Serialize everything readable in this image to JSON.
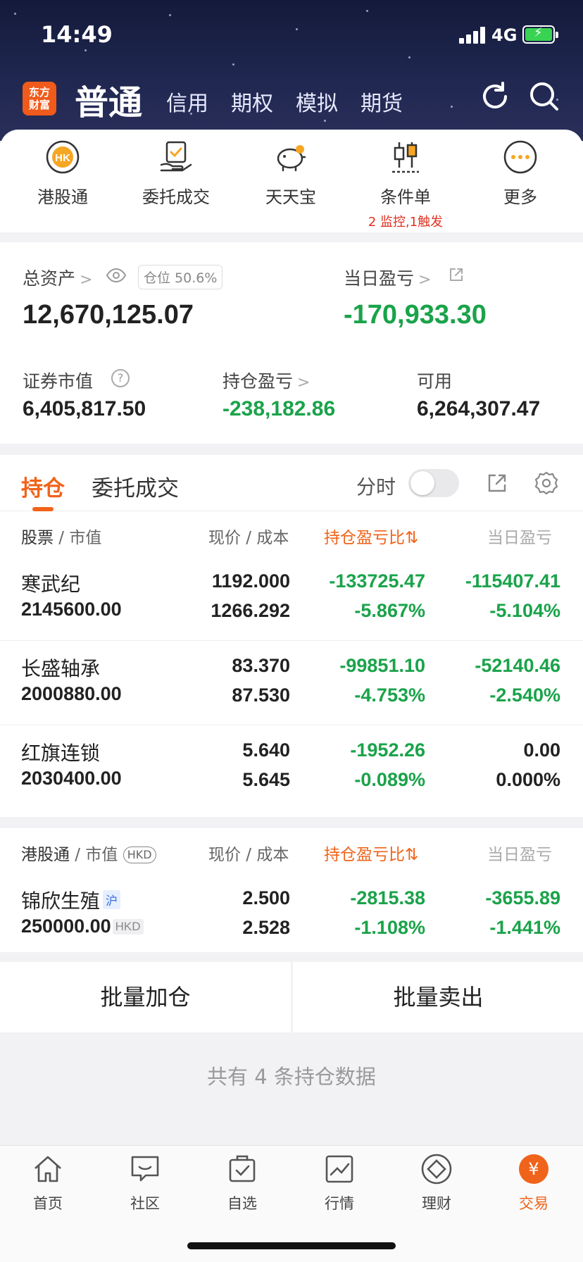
{
  "status": {
    "time": "14:49",
    "network": "4G"
  },
  "header": {
    "logo_line1": "东方",
    "logo_line2": "财富",
    "tabs": [
      "普通",
      "信用",
      "期权",
      "模拟",
      "期货"
    ],
    "active_tab": "普通"
  },
  "quick_entries": [
    {
      "label": "港股通",
      "icon": "hk-badge-icon"
    },
    {
      "label": "委托成交",
      "icon": "order-hand-icon"
    },
    {
      "label": "天天宝",
      "icon": "piggy-bank-icon"
    },
    {
      "label": "条件单",
      "icon": "candlestick-icon",
      "note": "2 监控,1触发"
    },
    {
      "label": "更多",
      "icon": "more-dots-icon"
    }
  ],
  "assets": {
    "total_label": "总资产",
    "total_value": "12,670,125.07",
    "position_badge": "仓位 50.6%",
    "daily_pl_label": "当日盈亏",
    "daily_pl_value": "-170,933.30",
    "securities_label": "证券市值",
    "securities_value": "6,405,817.50",
    "holding_pl_label": "持仓盈亏",
    "holding_pl_value": "-238,182.86",
    "available_label": "可用",
    "available_value": "6,264,307.47"
  },
  "holdings": {
    "tab_active": "持仓",
    "tab_other": "委托成交",
    "fenshi_label": "分时",
    "fenshi_on": false,
    "columns": {
      "stock": "股票",
      "stock_sub": "市值",
      "price": "现价",
      "price_sub": "成本",
      "pl_ratio": "持仓盈亏比",
      "daily": "当日盈亏"
    },
    "a_rows": [
      {
        "name": "寒武纪",
        "mv": "2145600.00",
        "price": "1192.000",
        "cost": "1266.292",
        "pl": "-133725.47",
        "pl_pct": "-5.867%",
        "daily": "-115407.41",
        "daily_pct": "-5.104%"
      },
      {
        "name": "长盛轴承",
        "mv": "2000880.00",
        "price": "83.370",
        "cost": "87.530",
        "pl": "-99851.10",
        "pl_pct": "-4.753%",
        "daily": "-52140.46",
        "daily_pct": "-2.540%"
      },
      {
        "name": "红旗连锁",
        "mv": "2030400.00",
        "price": "5.640",
        "cost": "5.645",
        "pl": "-1952.26",
        "pl_pct": "-0.089%",
        "daily": "0.00",
        "daily_pct": "0.000%"
      }
    ],
    "hk_columns": {
      "stock": "港股通",
      "stock_sub": "市值",
      "currency_chip": "HKD"
    },
    "hk_rows": [
      {
        "name": "锦欣生殖",
        "tag": "沪",
        "mv": "250000.00",
        "mv_tag": "HKD",
        "price": "2.500",
        "cost": "2.528",
        "pl": "-2815.38",
        "pl_pct": "-1.108%",
        "daily": "-3655.89",
        "daily_pct": "-1.441%"
      }
    ]
  },
  "batch": {
    "add": "批量加仓",
    "sell": "批量卖出"
  },
  "summary": "共有 4 条持仓数据",
  "tabbar": [
    {
      "label": "首页",
      "icon": "home-icon"
    },
    {
      "label": "社区",
      "icon": "chat-icon"
    },
    {
      "label": "自选",
      "icon": "bag-check-icon"
    },
    {
      "label": "行情",
      "icon": "trend-chart-icon"
    },
    {
      "label": "理财",
      "icon": "diamond-icon"
    },
    {
      "label": "交易",
      "icon": "yuan-icon",
      "active": true
    }
  ],
  "colors": {
    "accent": "#f0631a",
    "down": "#1aa34a",
    "alert": "#e0311f"
  }
}
